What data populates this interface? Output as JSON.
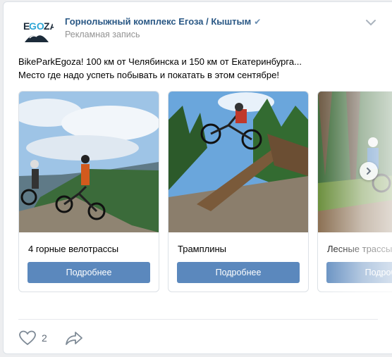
{
  "post": {
    "author": "Горнолыжный комплекс Егоза / Кыштым",
    "verified_icon": "check-icon",
    "subtitle": "Рекламная запись",
    "text_line1": "BikeParkEgoza! 100 км от Челябинска и 150 км от Екатеринбурга...",
    "text_line2": "Место где надо успеть побывать и покатать в этом сентябре!",
    "logo_text": "EGOZA"
  },
  "cards": [
    {
      "title": "4 горные велотрассы",
      "button": "Подробнее"
    },
    {
      "title": "Трамплины",
      "button": "Подробнее"
    },
    {
      "title": "Лесные трассы",
      "button": "Подробнее"
    }
  ],
  "footer": {
    "likes": "2"
  },
  "colors": {
    "link": "#2a5885",
    "button": "#5b88bd",
    "muted": "#939393"
  }
}
